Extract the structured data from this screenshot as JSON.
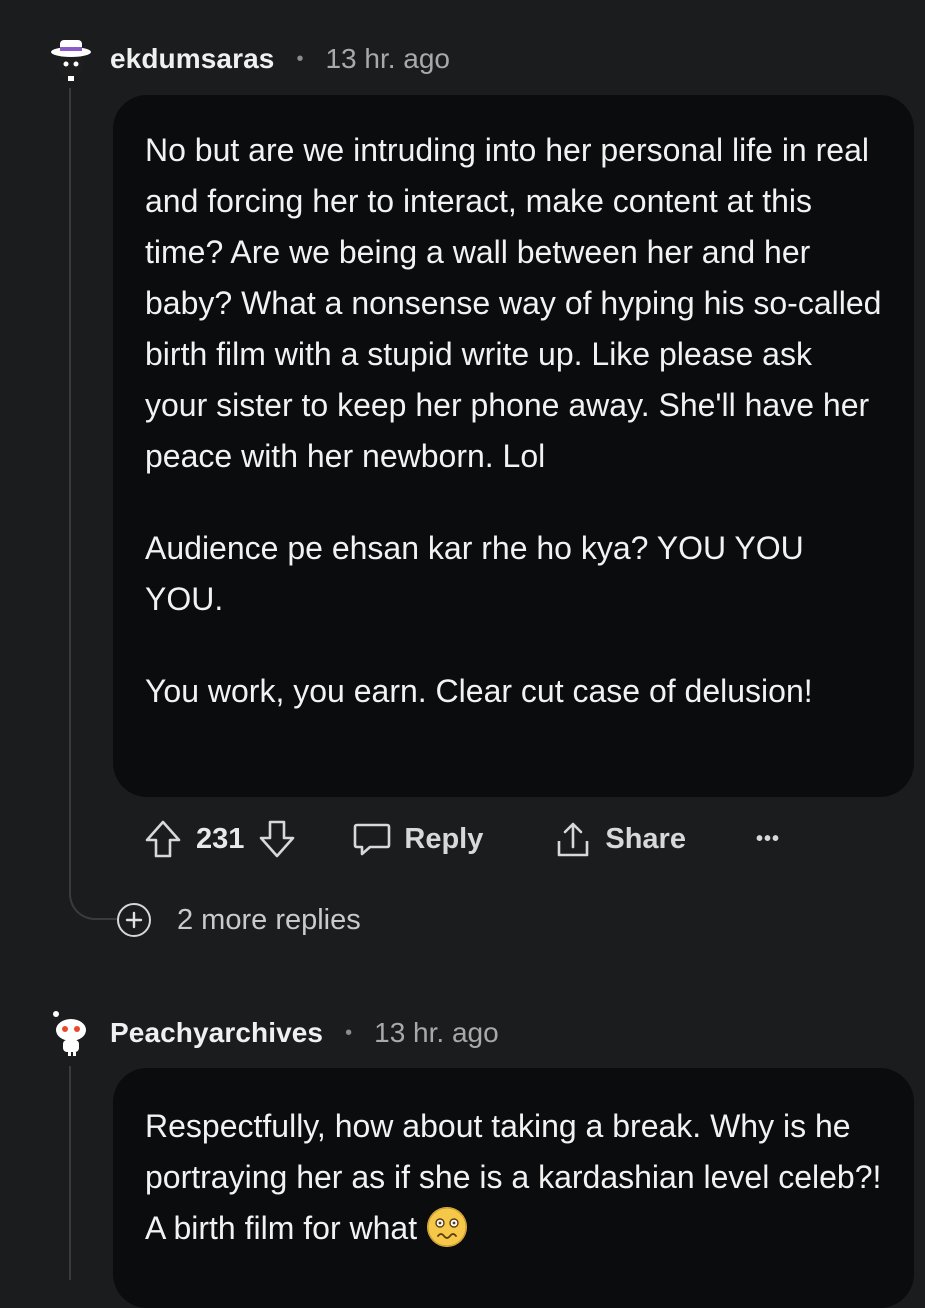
{
  "comments": [
    {
      "username": "ekdumsaras",
      "separator": "•",
      "time": "13 hr. ago",
      "paragraphs": [
        "No but are we intruding into her personal life in real and forcing her to interact, make content at this time? Are we being a wall between her and her baby? What a nonsense way of hyping his so-called birth film with a stupid write up. Like please ask your sister to keep her phone away. She'll have her peace with her newborn. Lol",
        "Audience pe ehsan kar rhe ho kya? YOU YOU YOU.",
        "You work, you earn. Clear cut case of delusion!"
      ],
      "votes": "231",
      "reply_label": "Reply",
      "share_label": "Share",
      "more_label": "•••",
      "more_replies": "2 more replies"
    },
    {
      "username": "Peachyarchives",
      "separator": "•",
      "time": "13 hr. ago",
      "text": "Respectfully, how about taking a break. Why is he portraying her as if she is a kardashian level celeb?! A birth film for what",
      "emoji": "woozy-face"
    }
  ],
  "icons": {
    "upvote": "upvote-arrow-icon",
    "downvote": "downvote-arrow-icon",
    "reply": "speech-bubble-icon",
    "share": "share-upload-icon",
    "more": "ellipsis-icon",
    "expand": "plus-circle-icon"
  },
  "colors": {
    "background": "#1b1c1e",
    "bubble": "#0b0c0d",
    "text": "#f2f2f2",
    "muted": "#a7a9ad"
  }
}
